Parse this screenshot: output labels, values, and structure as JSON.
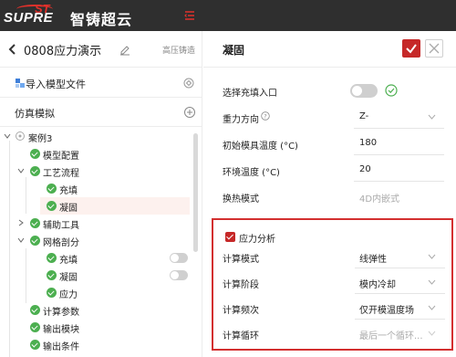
{
  "brand": {
    "logo_text_white": "SUPRE",
    "logo_text_red": "ST",
    "logo_cn": "智铸超云",
    "accent": "#c62828",
    "topbar_bg": "#2f2f2f"
  },
  "project": {
    "title": "0808应力演示",
    "type": "高压铸造"
  },
  "sidebar": {
    "import_label": "导入模型文件",
    "sim_label": "仿真模拟"
  },
  "tree": {
    "case": "案例3",
    "model_config": "模型配置",
    "process": "工艺流程",
    "filling": "充填",
    "solidification": "凝固",
    "aux_tools": "辅助工具",
    "mesh": "网格剖分",
    "mesh_filling": "充填",
    "mesh_solid": "凝固",
    "mesh_stress": "应力",
    "calc_params": "计算参数",
    "output_module": "输出模块",
    "output_cond": "输出条件"
  },
  "panel": {
    "title": "凝固",
    "fields": {
      "inlet_label": "选择充填入口",
      "gravity_label": "重力方向",
      "gravity_value": "Z-",
      "mold_temp_label": "初始模具温度 (°C)",
      "mold_temp_value": "180",
      "env_temp_label": "环境温度 (°C)",
      "env_temp_value": "20",
      "heat_label": "换热模式",
      "heat_value": "4D内嵌式"
    },
    "stress": {
      "title": "应力分析",
      "mode_label": "计算模式",
      "mode_value": "线弹性",
      "stage_label": "计算阶段",
      "stage_value": "模内冷却",
      "freq_label": "计算频次",
      "freq_value": "仅开模温度场",
      "cycle_label": "计算循环",
      "cycle_value": "最后一个循环..."
    }
  }
}
